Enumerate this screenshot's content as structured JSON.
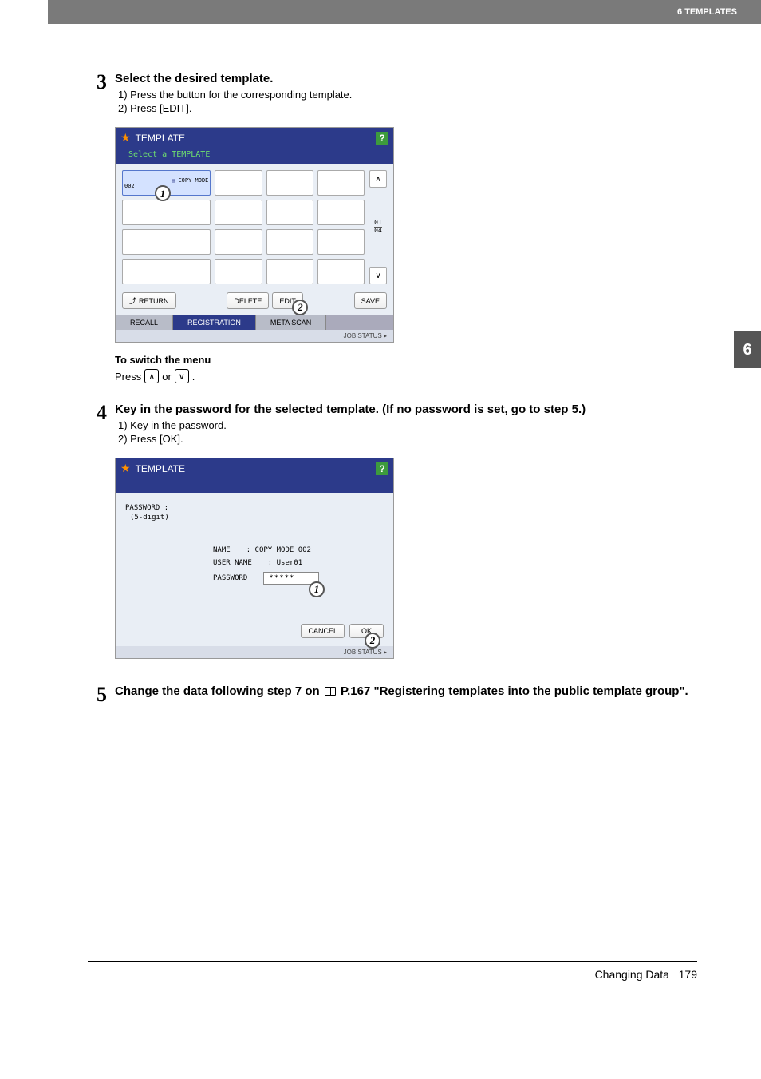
{
  "header": {
    "section": "6 TEMPLATES"
  },
  "side_tab": "6",
  "steps": {
    "s3": {
      "num": "3",
      "title": "Select the desired template.",
      "sub1": "1)   Press the button for the corresponding template.",
      "sub2": "2)   Press [EDIT].",
      "note_title": "To switch the menu",
      "note_press": "Press",
      "note_or": "or",
      "note_period": "."
    },
    "s4": {
      "num": "4",
      "title": "Key in the password for the selected template. (If no password is set, go to step 5.)",
      "sub1": "1)   Key in the password.",
      "sub2": "2)   Press [OK]."
    },
    "s5": {
      "num": "5",
      "title_a": "Change the data following step 7 on ",
      "title_b": " P.167 \"Registering templates into the public template group\"."
    }
  },
  "screen1": {
    "title": "TEMPLATE",
    "subtitle": "Select a TEMPLATE",
    "cell0": "COPY MODE\n002",
    "page_cur": "01",
    "page_tot": "04",
    "btn_return": "RETURN",
    "btn_delete": "DELETE",
    "btn_edit": "EDIT",
    "btn_save": "SAVE",
    "tab_recall": "RECALL",
    "tab_registration": "REGISTRATION",
    "tab_meta": "META SCAN",
    "status": "JOB STATUS",
    "help": "?"
  },
  "screen2": {
    "title": "TEMPLATE",
    "pw_label": "PASSWORD :",
    "pw_hint": "(5-digit)",
    "name_lbl": "NAME",
    "name_val": ": COPY MODE 002",
    "user_lbl": "USER NAME",
    "user_val": ": User01",
    "pass_lbl": "PASSWORD",
    "pass_val": "*****",
    "btn_cancel": "CANCEL",
    "btn_ok": "OK",
    "status": "JOB STATUS",
    "help": "?"
  },
  "footer": {
    "left": "Changing Data",
    "page": "179"
  }
}
